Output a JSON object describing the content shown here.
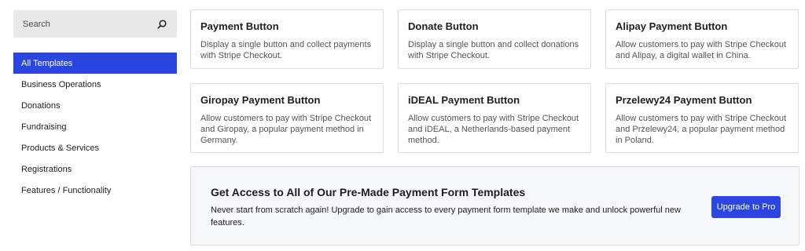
{
  "search": {
    "placeholder": "Search",
    "icon": "search-icon"
  },
  "sidebar": {
    "items": [
      {
        "label": "All Templates",
        "active": true
      },
      {
        "label": "Business Operations"
      },
      {
        "label": "Donations"
      },
      {
        "label": "Fundraising"
      },
      {
        "label": "Products & Services"
      },
      {
        "label": "Registrations"
      },
      {
        "label": "Features / Functionality"
      }
    ]
  },
  "templates": [
    {
      "title": "Payment Button",
      "description": "Display a single button and collect payments with Stripe Checkout."
    },
    {
      "title": "Donate Button",
      "description": "Display a single button and collect donations with Stripe Checkout."
    },
    {
      "title": "Alipay Payment Button",
      "description": "Allow customers to pay with Stripe Checkout and Alipay, a digital wallet in China."
    },
    {
      "title": "Giropay Payment Button",
      "description": "Allow customers to pay with Stripe Checkout and Giropay, a popular payment method in Germany."
    },
    {
      "title": "iDEAL Payment Button",
      "description": "Allow customers to pay with Stripe Checkout and iDEAL, a Netherlands-based payment method."
    },
    {
      "title": "Przelewy24 Payment Button",
      "description": "Allow customers to pay with Stripe Checkout and Przelewy24, a popular payment method in Poland."
    }
  ],
  "banner": {
    "title": "Get Access to All of Our Pre-Made Payment Form Templates",
    "description": "Never start from scratch again! Upgrade to gain access to every payment form template we make and unlock powerful new features.",
    "button_label": "Upgrade to Pro"
  },
  "colors": {
    "accent": "#2b46e0",
    "banner_bg": "#f6f7fb",
    "search_bg": "#e8e8e8"
  }
}
